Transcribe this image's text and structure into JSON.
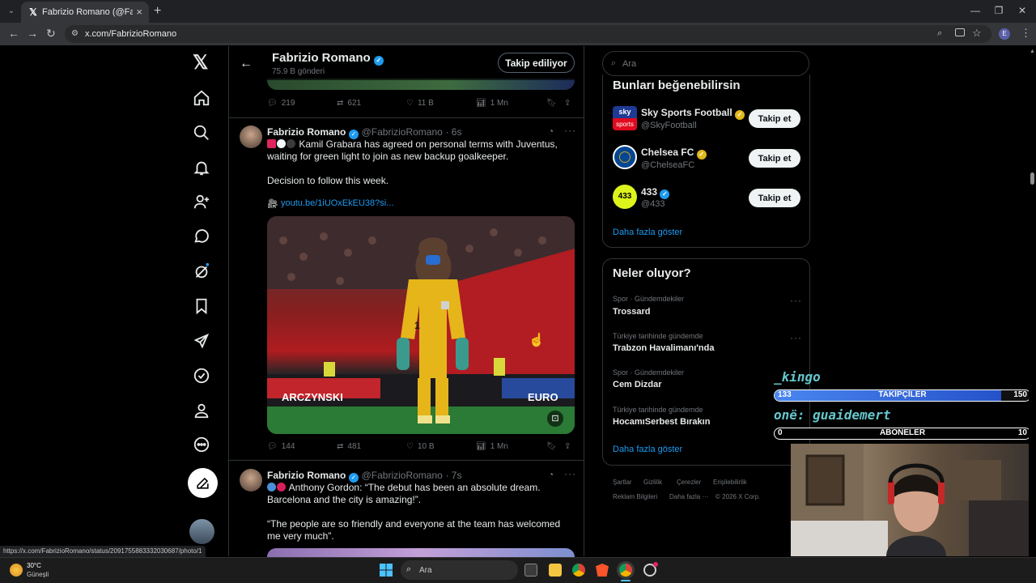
{
  "browser": {
    "tab_title": "Fabrizio Romano (@FabrizioRo...",
    "tab_close": "×",
    "new_tab": "+",
    "url": "x.com/FabrizioRomano",
    "profile_initial": "E",
    "window_controls": [
      "—",
      "❐",
      "✕"
    ]
  },
  "header": {
    "name": "Fabrizio Romano",
    "posts_count": "75.9 B gönderi",
    "follow_state": "Takip ediliyor"
  },
  "prev_tweet_actions": {
    "replies": "219",
    "reposts": "621",
    "likes": "11 B",
    "views": "1 Mn"
  },
  "tweets": [
    {
      "name": "Fabrizio Romano",
      "handle": "@FabrizioRomano",
      "time": "· 6s",
      "text1": "Kamil Grabara has agreed on personal terms with Juventus, waiting for green light to join as new backup goalkeeper.",
      "text2": "Decision to follow this week.",
      "link": "youtu.be/1iUOxEkEU38?si...",
      "replies": "144",
      "reposts": "481",
      "likes": "10 B",
      "views": "1 Mn"
    },
    {
      "name": "Fabrizio Romano",
      "handle": "@FabrizioRomano",
      "time": "· 7s",
      "text1": "Anthony Gordon: “The debut has been an absolute dream. Barcelona and the city is amazing!”.",
      "text2": "“The people are so friendly and everyone at the team has welcomed me very much”."
    }
  ],
  "photo_banner_left": "ARCZYNSKI",
  "photo_banner_right": "EURO",
  "photo_shirt_number": "1",
  "sidebar": {
    "search_placeholder": "Ara",
    "suggest_title": "Bunları beğenebilirsin",
    "suggestions": [
      {
        "name": "Sky Sports Football",
        "handle": "@SkyFootball",
        "button": "Takip et",
        "logo_top": "sky",
        "logo_bottom": "sports"
      },
      {
        "name": "Chelsea FC",
        "handle": "@ChelseaFC",
        "button": "Takip et"
      },
      {
        "name": "433",
        "handle": "@433",
        "button": "Takip et",
        "logo": "433"
      }
    ],
    "show_more": "Daha fazla göster",
    "trends_title": "Neler oluyor?",
    "trends": [
      {
        "context": "Spor · Gündemdekiler",
        "name": "Trossard"
      },
      {
        "context": "Türkiye tarihinde gündemde",
        "name": "Trabzon Havalimanı'nda"
      },
      {
        "context": "Spor · Gündemdekiler",
        "name": "Cem Dizdar"
      },
      {
        "context": "Türkiye tarihinde gündemde",
        "name": "HocamıSerbest Bırakın"
      }
    ],
    "trends_more": "Daha fazla göster",
    "footer_row1": [
      "Şartlar",
      "Gizlilik",
      "Çerezler",
      "Erişilebilirlik"
    ],
    "footer_row2": [
      "Reklam Bilgileri",
      "Daha fazla ···",
      "© 2026 X Corp."
    ]
  },
  "overlay": {
    "name1": "_kingo",
    "followers_label": "TAKİPÇİLER",
    "followers_current": "133",
    "followers_goal": "150",
    "followers_progress": 0.887,
    "name2": "onë: guaidemert",
    "subs_label": "ABONELER",
    "subs_current": "0",
    "subs_goal": "10",
    "subs_progress": 0
  },
  "status_url": "https://x.com/FabrizioRomano/status/2091755883332030687/photo/1",
  "taskbar": {
    "temp": "30°C",
    "weather": "Güneşli",
    "search": "Ara"
  },
  "colors": {
    "accent": "#1d9bf0",
    "bg": "#000000",
    "border": "#2f3336",
    "overlay_bar": "#2f6ee0"
  }
}
